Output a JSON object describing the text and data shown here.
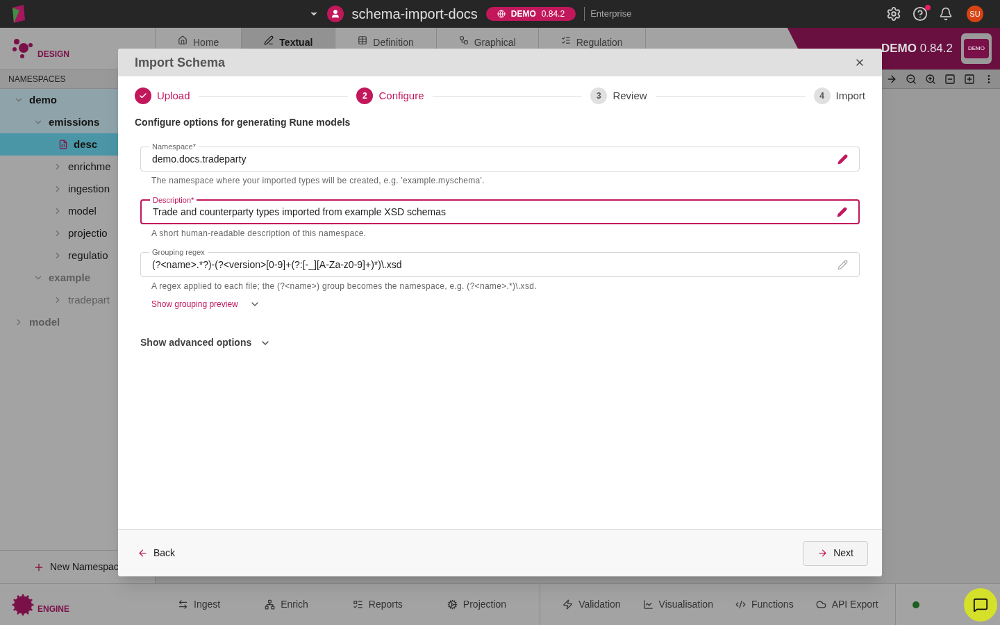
{
  "top_bar": {
    "project": "schema-import-docs",
    "badge_label": "DEMO",
    "badge_version": "0.84.2",
    "edition": "Enterprise",
    "avatar": "SU",
    "help_notification": true
  },
  "design": {
    "logo_label": "DESIGN",
    "banner_title": "DEMO",
    "banner_version": "0.84.2",
    "banner_logo": "DEMO",
    "tabs": [
      {
        "label": "Home",
        "selected": false
      },
      {
        "label": "Textual",
        "selected": true
      },
      {
        "label": "Definition",
        "selected": false
      },
      {
        "label": "Graphical",
        "selected": false
      },
      {
        "label": "Regulation",
        "selected": false
      }
    ]
  },
  "sidebar": {
    "heading": "NAMESPACES",
    "new_button": "New Namespac",
    "tree": [
      {
        "label": "demo",
        "kind": "folder",
        "expanded": true,
        "selected": false,
        "muted": false,
        "children": [
          {
            "label": "emissions",
            "kind": "folder",
            "expanded": true,
            "selected": false,
            "muted": false,
            "children": [
              {
                "label": "desc",
                "kind": "file",
                "expanded": false,
                "selected": true,
                "muted": false
              },
              {
                "label": "enrichme",
                "kind": "folder",
                "expanded": false,
                "selected": false,
                "muted": false
              },
              {
                "label": "ingestion",
                "kind": "folder",
                "expanded": false,
                "selected": false,
                "muted": false
              },
              {
                "label": "model",
                "kind": "folder",
                "expanded": false,
                "selected": false,
                "muted": false
              },
              {
                "label": "projectio",
                "kind": "folder",
                "expanded": false,
                "selected": false,
                "muted": false
              },
              {
                "label": "regulatio",
                "kind": "folder",
                "expanded": false,
                "selected": false,
                "muted": false
              }
            ]
          },
          {
            "label": "example",
            "kind": "folder",
            "expanded": true,
            "selected": false,
            "muted": true,
            "children": [
              {
                "label": "tradepart",
                "kind": "folder",
                "expanded": false,
                "selected": false,
                "muted": true
              }
            ]
          }
        ]
      },
      {
        "label": "model",
        "kind": "folder",
        "expanded": false,
        "selected": false,
        "muted": true
      }
    ]
  },
  "bottom_bar": {
    "logo_label": "ENGINE",
    "tools": [
      {
        "label": "Ingest"
      },
      {
        "label": "Enrich"
      },
      {
        "label": "Reports"
      },
      {
        "label": "Projection"
      }
    ],
    "tools_2": [
      {
        "label": "Validation"
      },
      {
        "label": "Visualisation"
      },
      {
        "label": "Functions"
      },
      {
        "label": "API Export"
      }
    ],
    "online": true
  },
  "modal": {
    "title": "Import Schema",
    "heading": "Configure options for generating Rune models",
    "steps": [
      {
        "label": "Upload",
        "done": true,
        "selected": false
      },
      {
        "number": "2",
        "label": "Configure",
        "done": false,
        "selected": true
      },
      {
        "number": "3",
        "label": "Review",
        "done": false,
        "selected": false
      },
      {
        "number": "4",
        "label": "Import",
        "done": false,
        "selected": false
      }
    ],
    "fields": [
      {
        "label": "Namespace*",
        "value": "demo.docs.tradeparty",
        "helper": "The namespace where your imported types will be created, e.g. 'example.myschema'.",
        "focused": false,
        "edited": true
      },
      {
        "label": "Description*",
        "value": "Trade and counterparty types imported from example XSD schemas",
        "helper": "A short human-readable description of this namespace.",
        "focused": true,
        "edited": true
      },
      {
        "label": "Grouping regex",
        "value": "(?<name>.*?)-(?<version>[0-9]+(?:[-_][A-Za-z0-9]+)*)\\.xsd",
        "helper": "A regex applied to each file; the (?<name>) group becomes the namespace, e.g. (?<name>.*)\\.xsd.",
        "focused": false,
        "edited": false,
        "link": "Show grouping preview"
      }
    ],
    "advanced": "Show advanced options",
    "back": "Back",
    "next": "Next"
  }
}
